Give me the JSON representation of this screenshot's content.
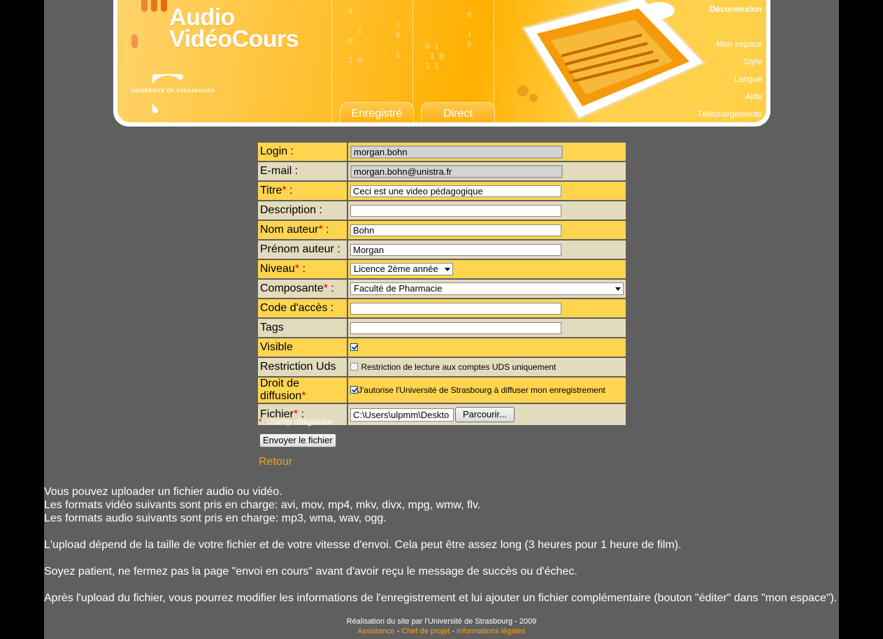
{
  "header": {
    "logo_line1": "Audio",
    "logo_line2": "VidéoCours",
    "university": "UNIVERSITÉ DE STRASBOURG",
    "tabs": [
      "Enregistré",
      "Direct"
    ],
    "logout": "Déconnexion",
    "nav": [
      "Mon espace",
      "Style",
      "Langue",
      "Aide",
      "Téléchargements"
    ]
  },
  "form": {
    "login_label": "Login :",
    "login_value": "morgan.bohn",
    "email_label": "E-mail :",
    "email_value": "morgan.bohn@unistra.fr",
    "titre_label": "Titre",
    "titre_value": "Ceci est une video pédagogique",
    "description_label": "Description :",
    "description_value": "",
    "nom_label": "Nom auteur",
    "nom_value": "Bohn",
    "prenom_label": "Prénom auteur :",
    "prenom_value": "Morgan",
    "niveau_label": "Niveau",
    "niveau_value": "Licence 2ème année",
    "composante_label": "Composante",
    "composante_value": "Faculté de Pharmacie",
    "code_label": "Code d'accès :",
    "code_value": "",
    "tags_label": "Tags",
    "tags_value": "",
    "visible_label": "Visible",
    "restriction_label": "Restriction Uds",
    "restriction_text": "Restriction de lecture aux comptes UDS uniquement",
    "droit_label": "Droit de diffusion",
    "droit_text": "J'autorise l'Université de Strasbourg à diffuser mon enregistrement",
    "fichier_label": "Fichier",
    "fichier_value": "C:\\Users\\ulpmm\\Deskto",
    "browse_button": "Parcourir...",
    "required_marker": "*",
    "colon": " :",
    "required_note": ": champ obligatoire",
    "submit_button": "Envoyer le fichier",
    "back_link": "Retour"
  },
  "info": {
    "line1": "Vous pouvez uploader un fichier audio ou vidéo.",
    "line2": "Les formats vidéo suivants sont pris en charge: avi, mov, mp4, mkv, divx, mpg, wmw, flv.",
    "line3": "Les formats audio suivants sont pris en charge: mp3, wma, wav, ogg.",
    "line4": "L'upload dépend de la taille de votre fichier et de votre vitesse d'envoi. Cela peut être assez long (3 heures pour 1 heure de film).",
    "line5": "Soyez patient, ne fermez pas la page \"envoi en cours\" avant d'avoir reçu le message de succès ou d'échec.",
    "line6": "Après l'upload du fichier, vous pourrez modifier les informations de l'enregistrement et lui ajouter un fichier complémentaire (bouton \"éditer\" dans \"mon espace\")."
  },
  "footer": {
    "credit": "Réalisation du site par l'Université de Strasbourg - 2009",
    "links": [
      "Assistance",
      "Chef de projet",
      "Informations légales"
    ],
    "separator": " - "
  },
  "colors": {
    "accent_orange": "#f5a31a",
    "row_yellow": "#ffd54f",
    "row_beige": "#e3dbbd",
    "page_bg": "#5f5f5f"
  }
}
